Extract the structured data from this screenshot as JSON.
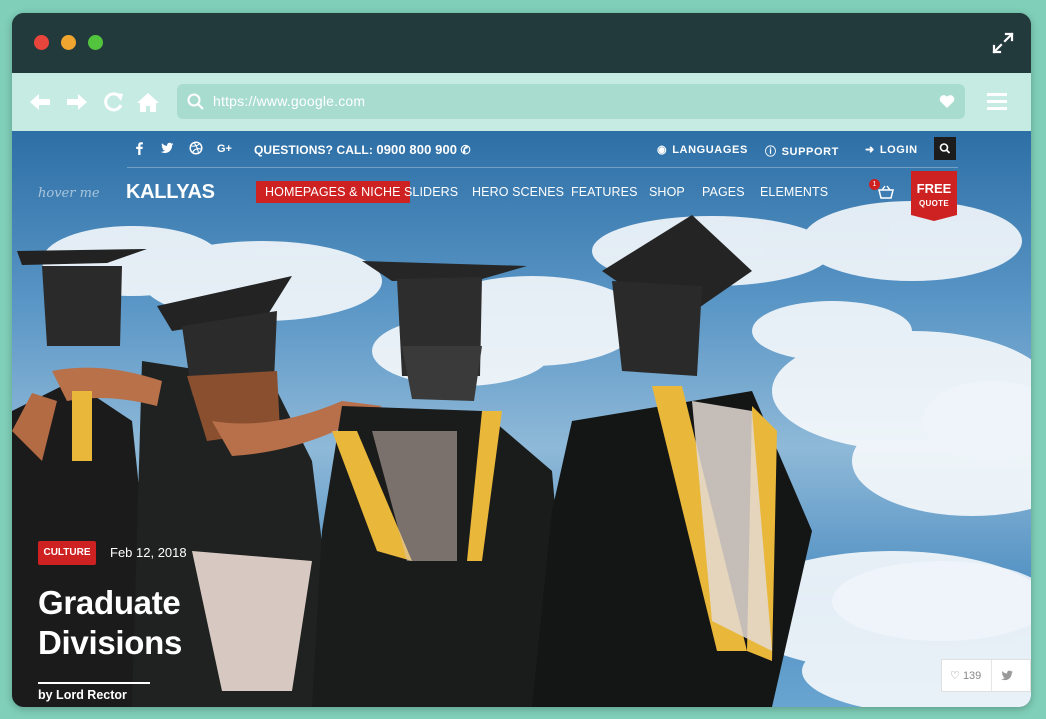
{
  "browser": {
    "url": "https://www.google.com"
  },
  "site": {
    "topbar": {
      "social_icons": [
        "facebook-icon",
        "twitter-icon",
        "dribbble-icon",
        "google-plus-icon"
      ],
      "questions_label": "QUESTIONS? CALL:",
      "phone": "0900 800 900",
      "languages": "LANGUAGES",
      "support": "SUPPORT",
      "login": "LOGIN"
    },
    "nav": {
      "hover_me": "hover me",
      "logo": "KALLYAS",
      "items": [
        "HOMEPAGES & NICHE",
        "SLIDERS",
        "HERO SCENES",
        "FEATURES",
        "SHOP",
        "PAGES",
        "ELEMENTS"
      ],
      "active_index": 0,
      "cart_count": "1",
      "free_quote_line1": "FREE",
      "free_quote_line2": "QUOTE"
    },
    "post": {
      "category": "CULTURE",
      "date": "Feb 12, 2018",
      "title_line1": "Graduate",
      "title_line2": "Divisions",
      "author": "by Lord Rector",
      "likes": "139"
    }
  },
  "colors": {
    "accent_red": "#cd2122",
    "frame_green": "#7fcfb9",
    "toolbar": "#c6ebe3",
    "titlebar": "#233a3d"
  }
}
